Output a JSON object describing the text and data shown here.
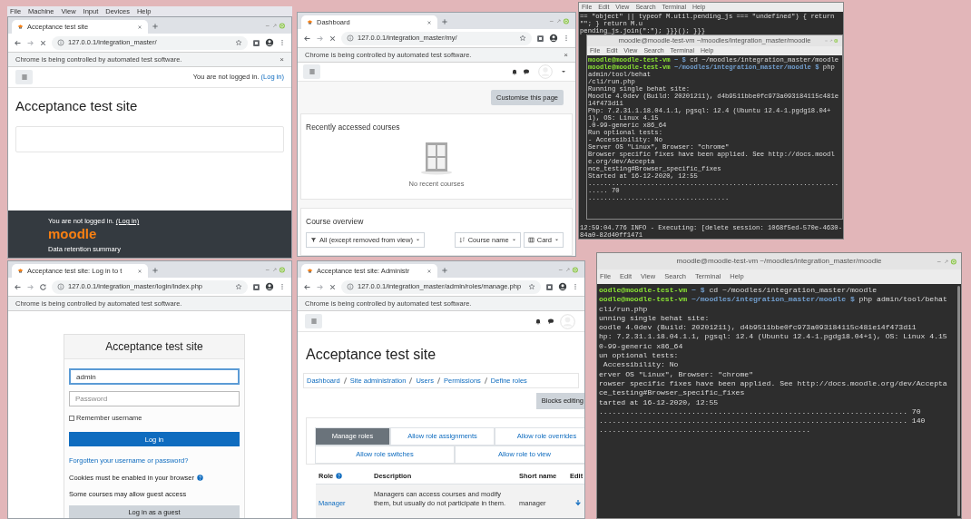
{
  "vm_menu": [
    "File",
    "Machine",
    "View",
    "Input",
    "Devices",
    "Help"
  ],
  "windows": [
    {
      "kind": "browser",
      "tab_title": "Acceptance test site",
      "loading": true,
      "url": "127.0.0.1/integration_master/",
      "infobar": "Chrome is being controlled by automated test software.",
      "infobar_close": "×",
      "page": {
        "kind": "front",
        "status_text": "You are not logged in. ",
        "status_link": "(Log in)",
        "title": "Acceptance test site",
        "footer_text": "You are not logged in. ",
        "footer_link": "(Log in)",
        "footer_logo": "moodle",
        "footer_item": "Data retention summary"
      }
    },
    {
      "kind": "browser",
      "tab_title": "Dashboard",
      "loading": true,
      "url": "127.0.0.1/integration_master/my/",
      "infobar": "Chrome is being controlled by automated test software.",
      "infobar_close": "×",
      "page": {
        "kind": "dashboard",
        "customise_button": "Customise this page",
        "recent_heading": "Recently accessed courses",
        "recent_empty": "No recent courses",
        "overview_heading": "Course overview",
        "filter": "All (except removed from view)",
        "sort": "Course name",
        "view": "Card"
      }
    },
    {
      "kind": "terminal",
      "menu": [
        "File",
        "Edit",
        "View",
        "Search",
        "Terminal",
        "Help"
      ],
      "lines": [
        {
          "kind": "output",
          "text": "== \"object\" || typeof M.util.pending_js === \"undefined\") { return \"\"; } return M.u"
        },
        {
          "kind": "output",
          "text": "pending_js.join(\":\"); }}}(); }}}"
        }
      ],
      "tail_lines": [
        {
          "kind": "output",
          "text": "12:59:04.776 INFO - Executing: [delete session: 1068f5ed-570e-4630-84a0-82d40ff1471"
        }
      ]
    },
    {
      "kind": "terminal",
      "title": "moodle@moodle-test-vm ~/moodles/integration_master/moodle",
      "menu": [
        "File",
        "Edit",
        "View",
        "Search",
        "Terminal",
        "Help"
      ],
      "lines": [
        {
          "kind": "prompt",
          "user": "moodle@moodle-test-vm",
          "path": "~",
          "symbol": "$",
          "command": "cd ~/moodles/integration_master/moodle"
        },
        {
          "kind": "prompt",
          "user": "moodle@moodle-test-vm",
          "path": "~/moodles/integration_master/moodle",
          "symbol": "$",
          "command": "php admin/tool/behat"
        },
        {
          "kind": "output",
          "text": "/cli/run.php"
        },
        {
          "kind": "output",
          "text": "Running single behat site:"
        },
        {
          "kind": "output",
          "text": "Moodle 4.0dev (Build: 20201211), d4b9511bbe0fc973a093184115c481e14f473d11"
        },
        {
          "kind": "output",
          "text": "Php: 7.2.31.1.18.04.1.1, pgsql: 12.4 (Ubuntu 12.4-1.pgdg18.04+1), OS: Linux 4.15"
        },
        {
          "kind": "output",
          "text": ".0-99-generic x86_64"
        },
        {
          "kind": "output",
          "text": "Run optional tests:"
        },
        {
          "kind": "output",
          "text": "- Accessibility: No"
        },
        {
          "kind": "output",
          "text": "Server OS \"Linux\", Browser: \"chrome\""
        },
        {
          "kind": "output",
          "text": "Browser specific fixes have been applied. See http://docs.moodle.org/dev/Accepta"
        },
        {
          "kind": "output",
          "text": "nce_testing#Browser_specific_fixes"
        },
        {
          "kind": "output",
          "text": "Started at 16-12-2020, 12:55"
        },
        {
          "kind": "output",
          "text": "..................................................................... 70"
        },
        {
          "kind": "output",
          "text": "...................................."
        }
      ]
    },
    {
      "kind": "browser",
      "tab_title": "Acceptance test site: Log in to t",
      "loading": false,
      "url": "127.0.0.1/integration_master/login/index.php",
      "infobar": "Chrome is being controlled by automated test software.",
      "page": {
        "kind": "login",
        "title": "Acceptance test site",
        "username": "admin",
        "password_placeholder": "Password",
        "remember": {
          "label": "Remember username",
          "checked": false
        },
        "login_button": "Log in",
        "forgot_link": "Forgotten your username or password?",
        "cookies_note": "Cookies must be enabled in your browser",
        "guest_note": "Some courses may allow guest access",
        "guest_button": "Log in as a guest"
      }
    },
    {
      "kind": "browser",
      "tab_title": "Acceptance test site: Administr",
      "loading": true,
      "url": "127.0.0.1/integration_master/admin/roles/manage.php",
      "infobar": "Chrome is being controlled by automated test software.",
      "page": {
        "kind": "roles",
        "title": "Acceptance test site",
        "breadcrumb": [
          "Dashboard",
          "Site administration",
          "Users",
          "Permissions",
          "Define roles"
        ],
        "blocks_button": "Blocks editing",
        "tabs": [
          {
            "label": "Manage roles",
            "selected": true
          },
          {
            "label": "Allow role assignments",
            "selected": false
          },
          {
            "label": "Allow role overrides",
            "selected": false
          },
          {
            "label": "Allow role switches",
            "selected": false
          },
          {
            "label": "Allow role to view",
            "selected": false
          }
        ],
        "table": {
          "columns": [
            "Role",
            "Description",
            "Short name",
            "Edit"
          ],
          "rows": [
            {
              "role": "Manager",
              "description": "Managers can access courses and modify them, but usually do not participate in them.",
              "short_name": "manager"
            }
          ]
        }
      }
    },
    {
      "kind": "terminal",
      "title": "moodle@moodle-test-vm ~/moodles/integration_master/moodle",
      "menu": [
        "File",
        "Edit",
        "View",
        "Search",
        "Terminal",
        "Help"
      ],
      "lines": [
        {
          "kind": "prompt",
          "user": "oodle@moodle-test-vm",
          "path": "~",
          "symbol": "$",
          "command": "cd ~/moodles/integration_master/moodle"
        },
        {
          "kind": "prompt",
          "user": "oodle@moodle-test-vm",
          "path": "~/moodles/integration_master/moodle",
          "symbol": "$",
          "command": "php admin/tool/behat"
        },
        {
          "kind": "output",
          "text": "cli/run.php"
        },
        {
          "kind": "output",
          "text": "unning single behat site:"
        },
        {
          "kind": "output",
          "text": "oodle 4.0dev (Build: 20201211), d4b9511bbe0fc973a093184115c481e14f473d11"
        },
        {
          "kind": "output",
          "text": "hp: 7.2.31.1.18.04.1.1, pgsql: 12.4 (Ubuntu 12.4-1.pgdg18.04+1), OS: Linux 4.15"
        },
        {
          "kind": "output",
          "text": "0-99-generic x86_64"
        },
        {
          "kind": "output",
          "text": "un optional tests:"
        },
        {
          "kind": "output",
          "text": " Accessibility: No"
        },
        {
          "kind": "output",
          "text": "erver OS \"Linux\", Browser: \"chrome\""
        },
        {
          "kind": "output",
          "text": "rowser specific fixes have been applied. See http://docs.moodle.org/dev/Accepta"
        },
        {
          "kind": "output",
          "text": "ce_testing#Browser_specific_fixes"
        },
        {
          "kind": "output",
          "text": "tarted at 16-12-2020, 12:55"
        },
        {
          "kind": "output",
          "text": "...................................................................... 70"
        },
        {
          "kind": "output",
          "text": "...................................................................... 140"
        },
        {
          "kind": "output",
          "text": "................................................"
        }
      ]
    }
  ]
}
